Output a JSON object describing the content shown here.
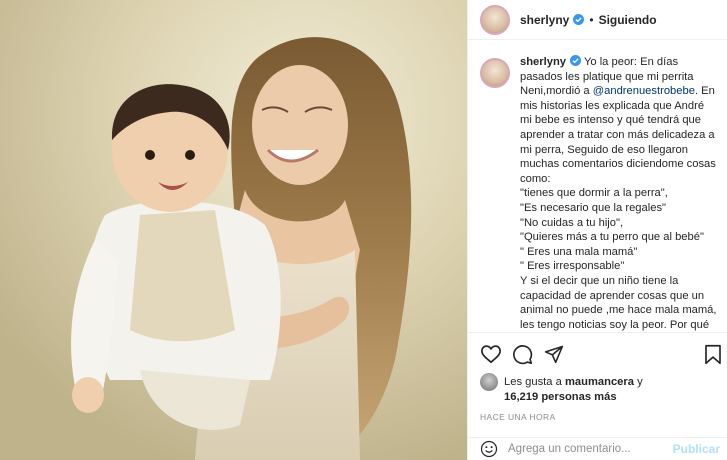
{
  "post": {
    "username": "sherlyny",
    "follow_status": "Siguiendo",
    "separator": "•"
  },
  "caption": {
    "username": "sherlyny",
    "text_before_mention": "Yo la peor: En días pasados les platique que mi perrita Neni,mordió a ",
    "mention": "@andrenuestrobebe",
    "text_after_mention": ". En mis historias les explicada que André mi bebe es intenso y qué tendrá que aprender a tratar con más delicadeza a mi perra, Seguido de eso llegaron muchas comentarios diciendome cosas como:\n\"tienes que dormir a la perra\",\n\"Es necesario que la regales\"\n\"No cuidas a tu hijo\",\n\"Quieres más a tu perro que al bebé\"\n\" Eres una mala mamá\"\n\" Eres irresponsable\"\nY si el decir que un niño tiene la capacidad de aprender cosas que un animal no puede ,me hace mala mamá, les tengo noticias soy la peor. Por qué"
  },
  "likes": {
    "prefix": "Les gusta a ",
    "first_user": "maumancera",
    "connector": " y",
    "count": "16,219 personas más"
  },
  "timestamp": "HACE UNA HORA",
  "comment": {
    "placeholder": "Agrega un comentario...",
    "publish_label": "Publicar"
  },
  "icons": {
    "verified": "verified-badge-icon",
    "like": "heart-icon",
    "comment": "comment-bubble-icon",
    "share": "paper-plane-icon",
    "save": "bookmark-icon",
    "emoji": "emoji-smile-icon"
  },
  "colors": {
    "verified_blue": "#3897f0",
    "mention": "#00376b",
    "muted": "#8e8e8e",
    "publish_disabled": "#b2dffc"
  }
}
